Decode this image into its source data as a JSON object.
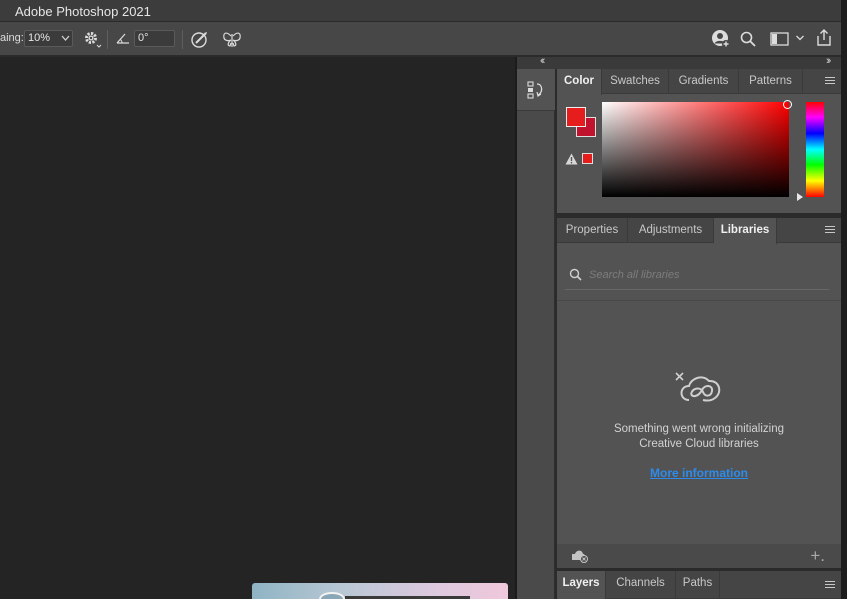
{
  "app": {
    "title": "Adobe Photoshop 2021"
  },
  "options_bar": {
    "smoothing_label": "aing:",
    "smoothing_value": "10%",
    "angle_value": "0°"
  },
  "color_panel": {
    "tabs": [
      "Color",
      "Swatches",
      "Gradients",
      "Patterns"
    ],
    "active_tab": "Color",
    "foreground_color": "#e51d1d",
    "background_color": "#c2132e"
  },
  "libraries_panel": {
    "tabs": [
      "Properties",
      "Adjustments",
      "Libraries"
    ],
    "active_tab": "Libraries",
    "search_placeholder": "Search all libraries",
    "error_line1": "Something went wrong initializing",
    "error_line2": "Creative Cloud libraries",
    "more_info_link": "More information"
  },
  "layers_panel": {
    "tabs": [
      "Layers",
      "Channels",
      "Paths"
    ],
    "active_tab": "Layers"
  },
  "colors": {
    "accent_link": "#2d8ceb",
    "panel_bg": "#535353",
    "canvas_bg": "#242424"
  }
}
